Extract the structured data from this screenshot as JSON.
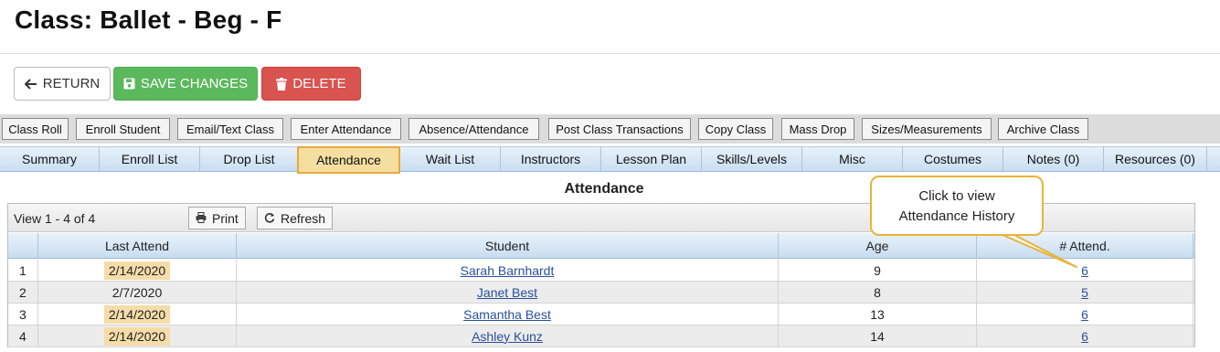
{
  "page": {
    "title": "Class: Ballet - Beg - F"
  },
  "buttons": {
    "return_label": "RETURN",
    "save_label": "SAVE CHANGES",
    "delete_label": "DELETE"
  },
  "actions": [
    "Class Roll",
    "Enroll Student",
    "Email/Text Class",
    "Enter Attendance",
    "Absence/Attendance",
    "Post Class Transactions",
    "Copy Class",
    "Mass Drop",
    "Sizes/Measurements",
    "Archive Class"
  ],
  "tabs": [
    "Summary",
    "Enroll List",
    "Drop List",
    "Attendance",
    "Wait List",
    "Instructors",
    "Lesson Plan",
    "Skills/Levels",
    "Misc",
    "Costumes",
    "Notes (0)",
    "Resources (0)"
  ],
  "active_tab": "Attendance",
  "section": {
    "title": "Attendance"
  },
  "grid": {
    "view_text": "View 1 - 4 of 4",
    "print_label": "Print",
    "refresh_label": "Refresh",
    "columns": [
      "Last Attend",
      "Student",
      "Age",
      "# Attend."
    ],
    "rows": [
      {
        "num": "1",
        "last_attend": "2/14/2020",
        "student": "Sarah Barnhardt",
        "age": "9",
        "attend": "6",
        "highlight": true
      },
      {
        "num": "2",
        "last_attend": "2/7/2020",
        "student": "Janet Best",
        "age": "8",
        "attend": "5",
        "highlight": false
      },
      {
        "num": "3",
        "last_attend": "2/14/2020",
        "student": "Samantha Best",
        "age": "13",
        "attend": "6",
        "highlight": true
      },
      {
        "num": "4",
        "last_attend": "2/14/2020",
        "student": "Ashley Kunz",
        "age": "14",
        "attend": "6",
        "highlight": true
      }
    ]
  },
  "callout": {
    "line1": "Click to view",
    "line2": "Attendance History"
  },
  "colors": {
    "save": "#5cb85c",
    "delete": "#d9534f",
    "highlight": "#f5dca8",
    "callout_border": "#e8b33a",
    "link": "#2a4f9c"
  },
  "icons": {
    "return": "arrow-left-icon",
    "save": "floppy-disk-icon",
    "delete": "trash-icon",
    "print": "printer-icon",
    "refresh": "refresh-icon"
  }
}
